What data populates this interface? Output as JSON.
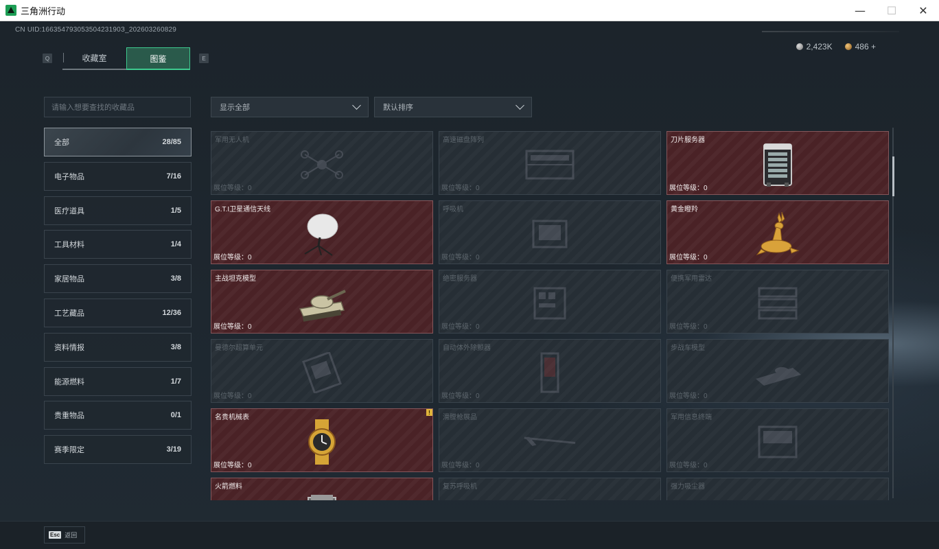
{
  "window": {
    "title": "三角洲行动",
    "minimize": "—",
    "maximize": "☐",
    "close": "✕"
  },
  "header": {
    "uid": "CN UID:16635479305350423190З_202603260829",
    "currency": [
      {
        "icon": "silver-coin-icon",
        "value": "2,423K"
      },
      {
        "icon": "gold-coin-icon",
        "value": "486 +"
      }
    ]
  },
  "tabs": {
    "left_key": "Q",
    "right_key": "E",
    "items": [
      {
        "label": "收藏室",
        "active": false
      },
      {
        "label": "图鉴",
        "active": true
      }
    ]
  },
  "search": {
    "placeholder": "请输入想要查找的收藏品"
  },
  "filters": {
    "show": "显示全部",
    "sort": "默认排序"
  },
  "categories": [
    {
      "label": "全部",
      "count": "28/85",
      "active": true
    },
    {
      "label": "电子物品",
      "count": "7/16"
    },
    {
      "label": "医疗道具",
      "count": "1/5"
    },
    {
      "label": "工具材料",
      "count": "1/4"
    },
    {
      "label": "家居物品",
      "count": "3/8"
    },
    {
      "label": "工艺藏品",
      "count": "12/36"
    },
    {
      "label": "资料情报",
      "count": "3/8"
    },
    {
      "label": "能源燃料",
      "count": "1/7"
    },
    {
      "label": "贵重物品",
      "count": "0/1"
    },
    {
      "label": "赛季限定",
      "count": "3/19"
    }
  ],
  "level_label": "展位等级：",
  "items": [
    {
      "name": "军用无人机",
      "level": "0",
      "owned": false,
      "icon": "drone-icon"
    },
    {
      "name": "高速磁盘阵列",
      "level": "0",
      "owned": false,
      "icon": "disk-array-icon"
    },
    {
      "name": "刀片服务器",
      "level": "0",
      "owned": true,
      "icon": "blade-server-icon"
    },
    {
      "name": "G.T.I卫星通信天线",
      "level": "0",
      "owned": true,
      "icon": "satellite-dish-icon"
    },
    {
      "name": "呼吸机",
      "level": "0",
      "owned": false,
      "icon": "ventilator-icon"
    },
    {
      "name": "黄金瞪羚",
      "level": "0",
      "owned": true,
      "icon": "golden-gazelle-icon"
    },
    {
      "name": "主战坦克模型",
      "level": "0",
      "owned": true,
      "icon": "tank-model-icon"
    },
    {
      "name": "绝密服务器",
      "level": "0",
      "owned": false,
      "icon": "secret-server-icon"
    },
    {
      "name": "便携军用雷达",
      "level": "0",
      "owned": false,
      "icon": "radar-icon"
    },
    {
      "name": "曼德尔超算单元",
      "level": "0",
      "owned": false,
      "icon": "supercomputer-unit-icon"
    },
    {
      "name": "自动体外除颤器",
      "level": "0",
      "owned": false,
      "icon": "defibrillator-icon"
    },
    {
      "name": "步战车模型",
      "level": "0",
      "owned": false,
      "icon": "ifv-model-icon"
    },
    {
      "name": "名贵机械表",
      "level": "0",
      "owned": true,
      "icon": "luxury-watch-icon",
      "badge": "!"
    },
    {
      "name": "滑膛枪展品",
      "level": "0",
      "owned": false,
      "icon": "musket-icon"
    },
    {
      "name": "军用信息终端",
      "level": "0",
      "owned": false,
      "icon": "military-terminal-icon"
    },
    {
      "name": "火箭燃料",
      "level": "",
      "owned": true,
      "icon": "rocket-fuel-icon"
    },
    {
      "name": "复苏呼吸机",
      "level": "",
      "owned": false,
      "icon": "resuscitator-icon"
    },
    {
      "name": "强力吸尘器",
      "level": "",
      "owned": false,
      "icon": "vacuum-cleaner-icon"
    }
  ],
  "footer": {
    "esc_key": "Esc",
    "back_label": "返回"
  }
}
